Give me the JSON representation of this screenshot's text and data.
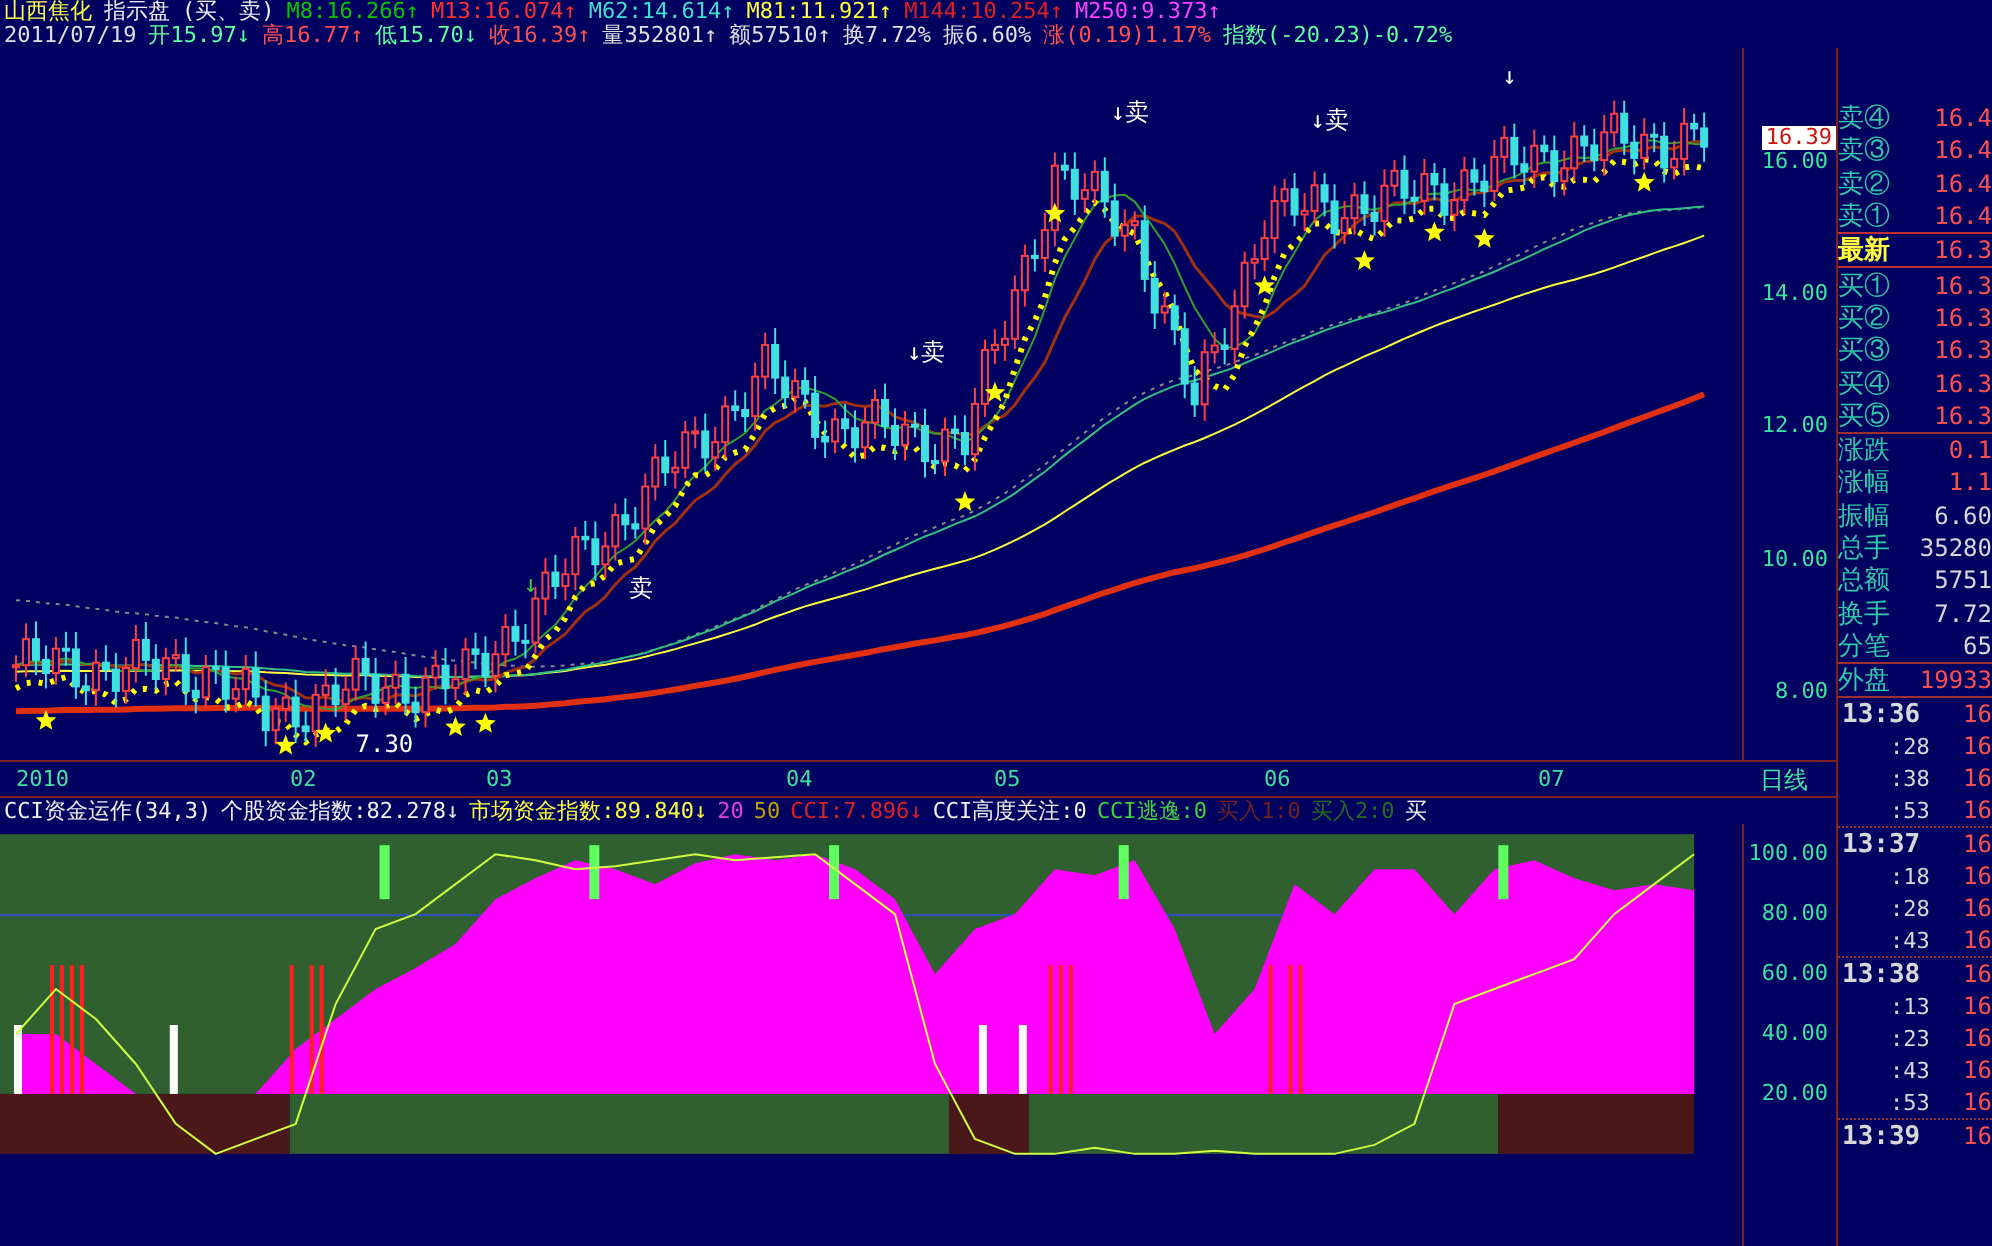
{
  "header": {
    "stock_name": "山西焦化",
    "panel_name": "指示盘",
    "mode": "(买、卖)",
    "averages": [
      {
        "text": "M8:16.266↑",
        "color": "#00c800"
      },
      {
        "text": "M13:16.074↑",
        "color": "#ff3030"
      },
      {
        "text": "M62:14.614↑",
        "color": "#40e0d0"
      },
      {
        "text": "M81:11.921↑",
        "color": "#ffff40"
      },
      {
        "text": "M144:10.254↑",
        "color": "#e02020"
      },
      {
        "text": "M250:9.373↑",
        "color": "#ff40ff"
      }
    ],
    "quote": [
      {
        "text": "2011/07/19",
        "color": "#e0e0e0"
      },
      {
        "text": "开15.97↓",
        "color": "#60ffa0"
      },
      {
        "text": "高16.77↑",
        "color": "#ff5050"
      },
      {
        "text": "低15.70↓",
        "color": "#60ffa0"
      },
      {
        "text": "收16.39↑",
        "color": "#ff5050"
      },
      {
        "text": "量352801↑",
        "color": "#e0e0e0"
      },
      {
        "text": "额57510↑",
        "color": "#e0e0e0"
      },
      {
        "text": "换7.72%",
        "color": "#e0e0e0"
      },
      {
        "text": "振6.60%",
        "color": "#e0e0e0"
      },
      {
        "text": "涨(0.19)1.17%",
        "color": "#ff5050"
      },
      {
        "text": "指数(-20.23)-0.72%",
        "color": "#60ffa0"
      }
    ]
  },
  "price_chart": {
    "last_price": "16.39",
    "yticks": [
      "16.00",
      "14.00",
      "12.00",
      "10.00",
      "8.00"
    ],
    "annotations": [
      {
        "text": "↓卖",
        "kind": "sell"
      },
      {
        "text": "↓卖",
        "kind": "sell"
      },
      {
        "text": "↓卖",
        "kind": "sell"
      },
      {
        "text": "卖",
        "kind": "sell"
      },
      {
        "text": "↓",
        "kind": "arrow"
      },
      {
        "text": "↓",
        "kind": "sell"
      },
      {
        "text": "7.30",
        "kind": "low"
      }
    ],
    "dates": [
      "2010",
      "02",
      "03",
      "04",
      "05",
      "06",
      "07"
    ],
    "period": "日线"
  },
  "indicator": {
    "title": "CCI资金运作(34,3)",
    "readings": [
      {
        "text": "个股资金指数:82.278↓",
        "color": "#f0f0f0"
      },
      {
        "text": "市场资金指数:89.840↓",
        "color": "#ffff40"
      },
      {
        "text": "20",
        "color": "#e040e0"
      },
      {
        "text": "50",
        "color": "#c0a000"
      },
      {
        "text": "CCI:7.896↓",
        "color": "#e02020"
      },
      {
        "text": "CCI高度关注:0",
        "color": "#f0f0f0"
      },
      {
        "text": "CCI逃逸:0",
        "color": "#40d040"
      },
      {
        "text": "买入1:0",
        "color": "#702020"
      },
      {
        "text": "买入2:0",
        "color": "#207020"
      },
      {
        "text": "买",
        "color": "#f0f0f0"
      }
    ],
    "yticks": [
      "100.00",
      "80.00",
      "60.00",
      "40.00",
      "20.00"
    ]
  },
  "order_book": {
    "sell": [
      {
        "label": "卖④",
        "price": "16.4"
      },
      {
        "label": "卖③",
        "price": "16.4"
      },
      {
        "label": "卖②",
        "price": "16.4"
      },
      {
        "label": "卖①",
        "price": "16.4"
      }
    ],
    "latest": {
      "label": "最新",
      "price": "16.3"
    },
    "buy": [
      {
        "label": "买①",
        "price": "16.3"
      },
      {
        "label": "买②",
        "price": "16.3"
      },
      {
        "label": "买③",
        "price": "16.3"
      },
      {
        "label": "买④",
        "price": "16.3"
      },
      {
        "label": "买⑤",
        "price": "16.3"
      }
    ]
  },
  "stats": [
    {
      "label": "涨跌",
      "value": "0.1",
      "color": "#ff5050"
    },
    {
      "label": "涨幅",
      "value": "1.1",
      "color": "#ff5050"
    },
    {
      "label": "振幅",
      "value": "6.60",
      "color": "#d8d8d8"
    },
    {
      "label": "总手",
      "value": "35280",
      "color": "#d8d8d8"
    },
    {
      "label": "总额",
      "value": "5751",
      "color": "#d8d8d8"
    },
    {
      "label": "换手",
      "value": "7.72",
      "color": "#d8d8d8"
    },
    {
      "label": "分笔",
      "value": "65",
      "color": "#d8d8d8"
    }
  ],
  "outer": {
    "label": "外盘",
    "value": "19933"
  },
  "ticks": [
    {
      "time": "13:36",
      "price": "16",
      "trades": [
        {
          "time": ":28",
          "price": "16"
        },
        {
          "time": ":38",
          "price": "16"
        },
        {
          "time": ":53",
          "price": "16"
        }
      ]
    },
    {
      "time": "13:37",
      "price": "16",
      "trades": [
        {
          "time": ":18",
          "price": "16"
        },
        {
          "time": ":28",
          "price": "16"
        },
        {
          "time": ":43",
          "price": "16"
        }
      ]
    },
    {
      "time": "13:38",
      "price": "16",
      "trades": [
        {
          "time": ":13",
          "price": "16"
        },
        {
          "time": ":23",
          "price": "16"
        },
        {
          "time": ":43",
          "price": "16"
        },
        {
          "time": ":53",
          "price": "16"
        }
      ]
    },
    {
      "time": "13:39",
      "price": "16"
    }
  ]
}
